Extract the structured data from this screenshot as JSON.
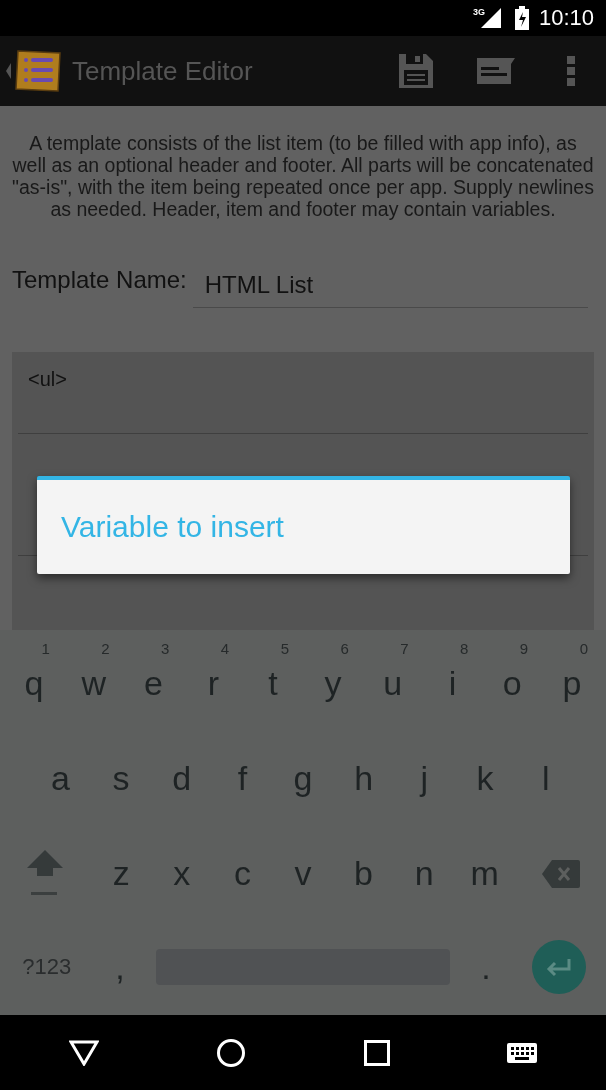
{
  "status_bar": {
    "network": "3G",
    "time": "10:10"
  },
  "app_bar": {
    "title": "Template Editor"
  },
  "description": "A template consists of the list item (to be filled with app info), as well as an optional header and footer. All parts will be concatenated \"as-is\", with the item being repeated once per app. Supply newlines as needed. Header, item and footer may contain variables.",
  "template_name": {
    "label": "Template Name:",
    "value": "HTML List"
  },
  "template_fields": [
    {
      "value": "<ul>"
    }
  ],
  "dialog": {
    "title": "Variable to insert"
  },
  "keyboard": {
    "rows": [
      [
        {
          "kind": "letter",
          "label": "q",
          "hint": "1"
        },
        {
          "kind": "letter",
          "label": "w",
          "hint": "2"
        },
        {
          "kind": "letter",
          "label": "e",
          "hint": "3"
        },
        {
          "kind": "letter",
          "label": "r",
          "hint": "4"
        },
        {
          "kind": "letter",
          "label": "t",
          "hint": "5"
        },
        {
          "kind": "letter",
          "label": "y",
          "hint": "6"
        },
        {
          "kind": "letter",
          "label": "u",
          "hint": "7"
        },
        {
          "kind": "letter",
          "label": "i",
          "hint": "8"
        },
        {
          "kind": "letter",
          "label": "o",
          "hint": "9"
        },
        {
          "kind": "letter",
          "label": "p",
          "hint": "0"
        }
      ],
      [
        {
          "kind": "letter",
          "label": "a"
        },
        {
          "kind": "letter",
          "label": "s"
        },
        {
          "kind": "letter",
          "label": "d"
        },
        {
          "kind": "letter",
          "label": "f"
        },
        {
          "kind": "letter",
          "label": "g"
        },
        {
          "kind": "letter",
          "label": "h"
        },
        {
          "kind": "letter",
          "label": "j"
        },
        {
          "kind": "letter",
          "label": "k"
        },
        {
          "kind": "letter",
          "label": "l"
        }
      ],
      [
        {
          "kind": "shift"
        },
        {
          "kind": "letter",
          "label": "z"
        },
        {
          "kind": "letter",
          "label": "x"
        },
        {
          "kind": "letter",
          "label": "c"
        },
        {
          "kind": "letter",
          "label": "v"
        },
        {
          "kind": "letter",
          "label": "b"
        },
        {
          "kind": "letter",
          "label": "n"
        },
        {
          "kind": "letter",
          "label": "m"
        },
        {
          "kind": "backspace"
        }
      ]
    ],
    "bottom_bar": {
      "symbols_key": "?123",
      "comma_key": ",",
      "period_key": "."
    }
  }
}
